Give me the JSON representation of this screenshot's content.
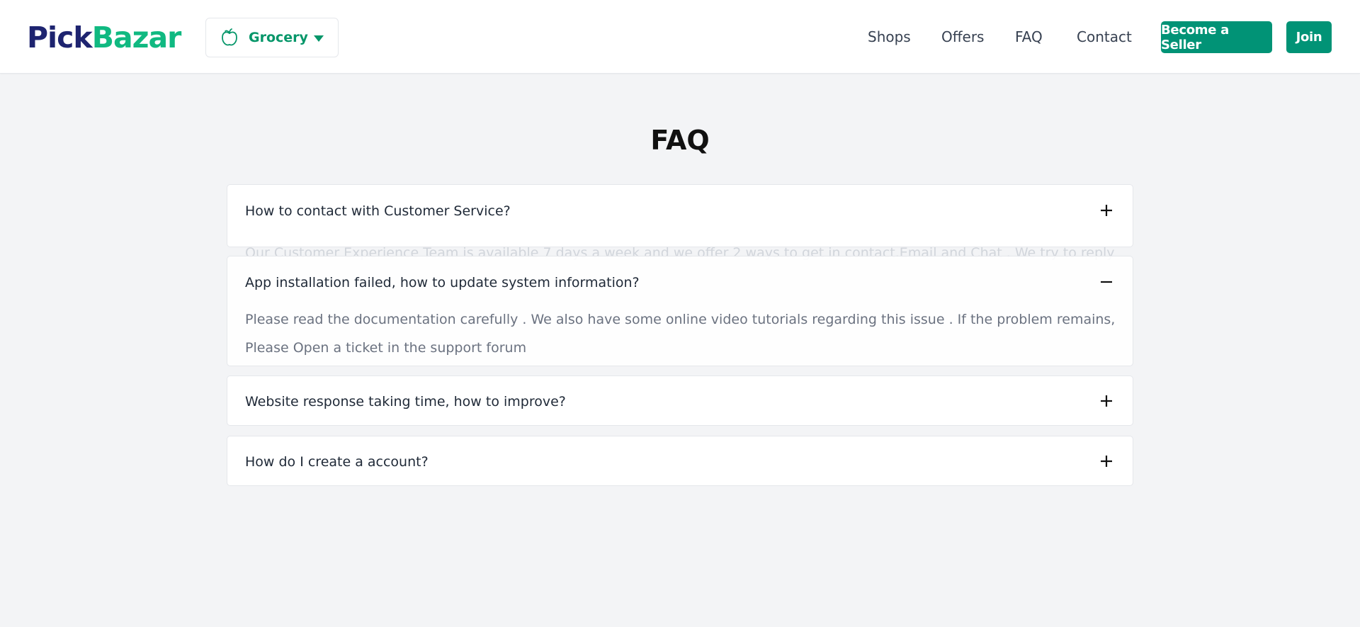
{
  "header": {
    "logo_part1": "Pick",
    "logo_part2": "Bazar",
    "shop_selector": {
      "label": "Grocery",
      "icon": "apple-icon"
    },
    "nav": [
      "Shops",
      "Offers",
      "FAQ",
      "Contact"
    ],
    "become_seller": "Become a Seller",
    "join": "Join"
  },
  "page": {
    "title": "FAQ"
  },
  "faq": [
    {
      "question": "How to contact with Customer Service?",
      "answer_fragment": "Our Customer Experience Team is available 7 days a week and we offer 2 ways to get in contact.Email and Chat . We try to reply quickly, so",
      "expanded": false
    },
    {
      "question": "App installation failed, how to update system information?",
      "answer": "Please read the documentation carefully . We also have some online video tutorials regarding this issue . If the problem remains, Please Open a ticket in the support forum",
      "expanded": true
    },
    {
      "question": "Website response taking time, how to improve?",
      "expanded": false
    },
    {
      "question": "How do I create a account?",
      "expanded": false
    }
  ],
  "colors": {
    "brand_dark": "#1e2470",
    "brand_green": "#10b981",
    "button": "#019376",
    "page_bg": "#f3f4f6"
  }
}
